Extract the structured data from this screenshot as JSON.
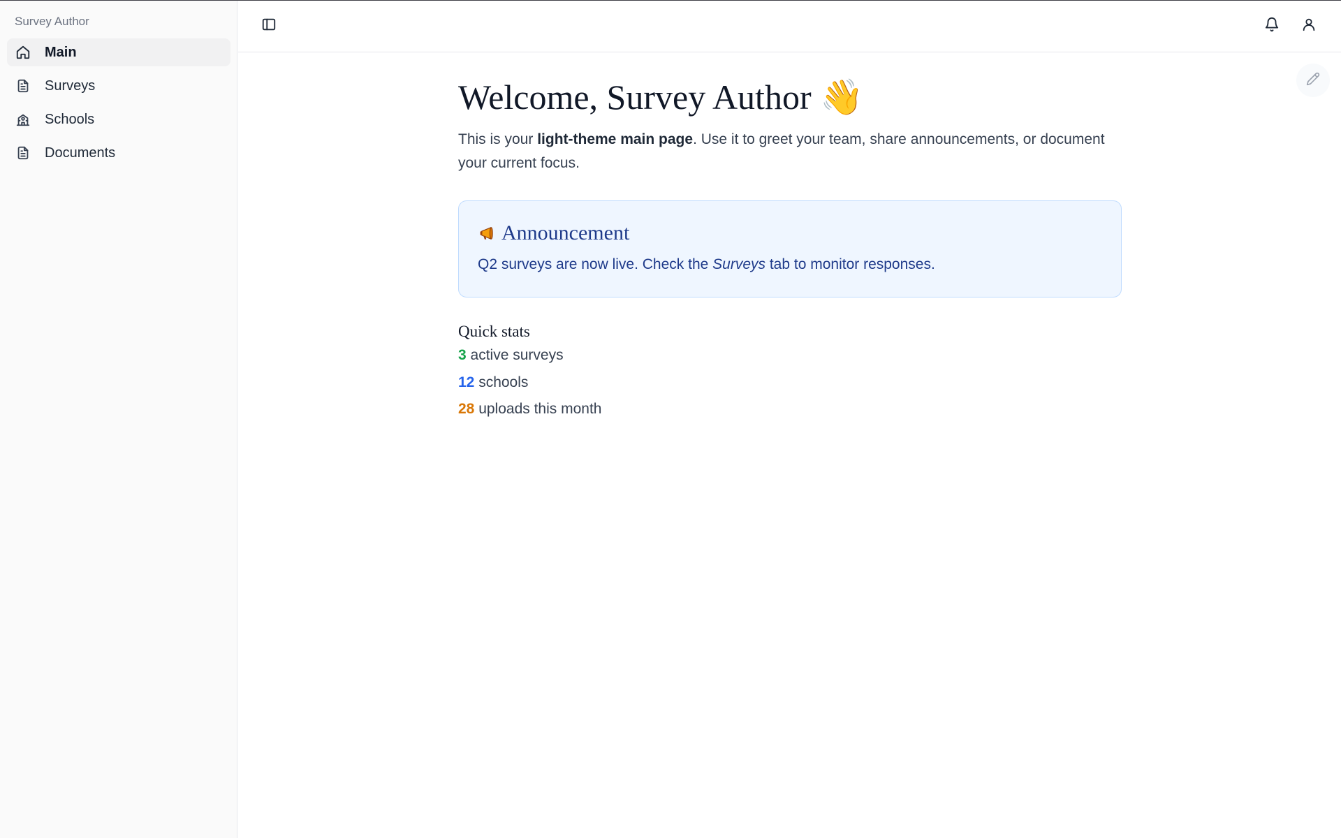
{
  "sidebar": {
    "title": "Survey Author",
    "items": [
      {
        "label": "Main",
        "icon": "home-icon",
        "active": true
      },
      {
        "label": "Surveys",
        "icon": "document-icon",
        "active": false
      },
      {
        "label": "Schools",
        "icon": "school-icon",
        "active": false
      },
      {
        "label": "Documents",
        "icon": "document-icon",
        "active": false
      }
    ]
  },
  "header": {
    "toggle_icon": "sidebar-toggle-icon",
    "notifications_icon": "bell-icon",
    "account_icon": "user-icon",
    "edit_icon": "pencil-icon"
  },
  "main": {
    "title": "Welcome, Survey Author",
    "title_emoji": "👋",
    "intro_prefix": "This is your ",
    "intro_bold": "light-theme main page",
    "intro_suffix": ". Use it to greet your team, share announcements, or document your current focus.",
    "announcement": {
      "icon": "megaphone-icon",
      "title": "Announcement",
      "text_prefix": "Q2 surveys are now live. Check the ",
      "text_italic": "Surveys",
      "text_suffix": " tab to monitor responses."
    },
    "stats_title": "Quick stats",
    "stats": [
      {
        "value": "3",
        "label": " active surveys",
        "color": "#16a34a"
      },
      {
        "value": "12",
        "label": " schools",
        "color": "#2563eb"
      },
      {
        "value": "28",
        "label": " uploads this month",
        "color": "#d97706"
      }
    ]
  },
  "colors": {
    "sidebar_bg": "#fafafa",
    "active_item_bg": "#f1f1f2",
    "callout_bg": "#eff6ff",
    "callout_border": "#bfdbfe",
    "callout_text": "#1e3a8a"
  }
}
